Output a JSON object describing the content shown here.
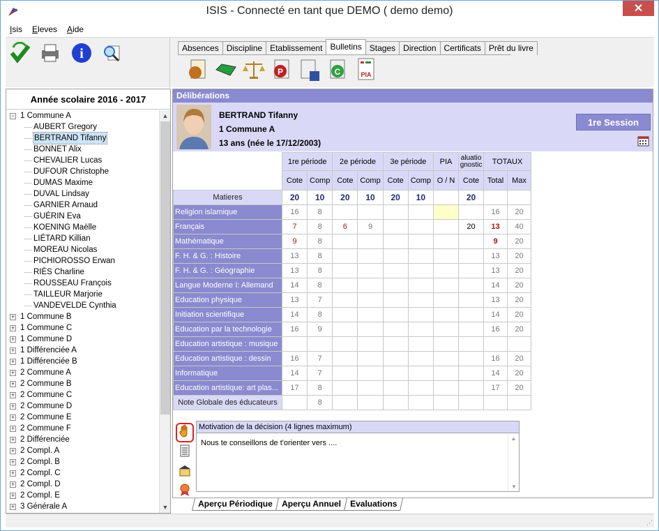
{
  "window": {
    "title": "ISIS - Connecté en tant que DEMO ( demo demo)",
    "close": "✕"
  },
  "menu": [
    {
      "label": "Isis",
      "key": "I"
    },
    {
      "label": "Eleves",
      "key": "E"
    },
    {
      "label": "Aide",
      "key": "A"
    }
  ],
  "tabs": [
    "Absences",
    "Discipline",
    "Etablissement",
    "Bulletins",
    "Stages",
    "Direction",
    "Certificats",
    "Prêt du livre"
  ],
  "active_tab": "Bulletins",
  "school_year": "Année scolaire 2016 - 2017",
  "tree": {
    "open_class": "1 Commune A",
    "students": [
      "AUBERT Gregory",
      "BERTRAND Tifanny",
      "BONNET Alix",
      "CHEVALIER Lucas",
      "DUFOUR Christophe",
      "DUMAS Maxime",
      "DUVAL Lindsay",
      "GARNIER Arnaud",
      "GUÉRIN Eva",
      "KOENING Maëlle",
      "LIÉTARD Killian",
      "MOREAU Nicolas",
      "PICHIOROSSO Erwan",
      "RIÈS Charline",
      "ROUSSEAU François",
      "TAILLEUR Marjorie",
      "VANDEVELDE Cynthia"
    ],
    "selected": "BERTRAND Tifanny",
    "classes": [
      "1 Commune B",
      "1 Commune C",
      "1 Commune D",
      "1 Différenciée A",
      "1 Différenciée B",
      "2 Commune A",
      "2 Commune B",
      "2 Commune C",
      "2 Commune D",
      "2 Commune E",
      "2 Commune F",
      "2 Différenciée",
      "2 Compl. A",
      "2 Compl. B",
      "2 Compl. C",
      "2 Compl. D",
      "2 Compl. E",
      "3 Générale A"
    ]
  },
  "panel_title": "Délibérations",
  "student": {
    "name": "BERTRAND Tifanny",
    "class": "1 Commune A",
    "age": "13 ans (née le 17/12/2003)"
  },
  "session": "1re Session",
  "grid": {
    "periods": [
      "1re période",
      "2e période",
      "3e période",
      "PIA",
      "aluatio gnostic",
      "TOTAUX"
    ],
    "sub": [
      "Cote",
      "Comp",
      "Cote",
      "Comp",
      "Cote",
      "Comp",
      "O / N",
      "Cote",
      "Total",
      "Max"
    ],
    "matieres": "Matieres",
    "weights": [
      "20",
      "10",
      "20",
      "10",
      "20",
      "10",
      "",
      "20",
      "",
      ""
    ],
    "rows": [
      {
        "subject": "Religion islamique",
        "c": [
          "16",
          "8",
          "",
          "",
          "",
          "",
          "",
          "",
          "16",
          "20"
        ]
      },
      {
        "subject": "Français",
        "c": [
          "7",
          "8",
          "6",
          "9",
          "",
          "",
          "",
          "20",
          "13",
          "40"
        ]
      },
      {
        "subject": "Mathématique",
        "c": [
          "9",
          "8",
          "",
          "",
          "",
          "",
          "",
          "",
          "9",
          "20"
        ]
      },
      {
        "subject": "F. H. & G. : Histoire",
        "c": [
          "13",
          "8",
          "",
          "",
          "",
          "",
          "",
          "",
          "13",
          "20"
        ]
      },
      {
        "subject": "F. H. & G. : Géographie",
        "c": [
          "13",
          "8",
          "",
          "",
          "",
          "",
          "",
          "",
          "13",
          "20"
        ]
      },
      {
        "subject": "Langue Moderne I: Allemand",
        "c": [
          "14",
          "8",
          "",
          "",
          "",
          "",
          "",
          "",
          "14",
          "20"
        ]
      },
      {
        "subject": "Education physique",
        "c": [
          "13",
          "7",
          "",
          "",
          "",
          "",
          "",
          "",
          "13",
          "20"
        ]
      },
      {
        "subject": "Initiation scientifique",
        "c": [
          "14",
          "8",
          "",
          "",
          "",
          "",
          "",
          "",
          "14",
          "20"
        ]
      },
      {
        "subject": "Education par la technologie",
        "c": [
          "16",
          "9",
          "",
          "",
          "",
          "",
          "",
          "",
          "16",
          "20"
        ]
      },
      {
        "subject": "Education artistique : musique",
        "c": [
          "",
          "",
          "",
          "",
          "",
          "",
          "",
          "",
          "",
          ""
        ]
      },
      {
        "subject": "Education artistique : dessin",
        "c": [
          "16",
          "7",
          "",
          "",
          "",
          "",
          "",
          "",
          "16",
          "20"
        ]
      },
      {
        "subject": "Informatique",
        "c": [
          "14",
          "7",
          "",
          "",
          "",
          "",
          "",
          "",
          "14",
          "20"
        ]
      },
      {
        "subject": "Education artistique: art plas...",
        "c": [
          "17",
          "8",
          "",
          "",
          "",
          "",
          "",
          "",
          "17",
          "20"
        ]
      }
    ],
    "footer": {
      "label": "Note Globale des éducateurs",
      "value": "8"
    }
  },
  "motivation": {
    "header": "Motivation de la décision (4 lignes maximum)",
    "text": "Nous te conseillons de t'orienter vers ...."
  },
  "bottom_tabs": [
    "Aperçu Périodique",
    "Aperçu Annuel",
    "Evaluations"
  ],
  "colors": {
    "accent": "#8a8ad0",
    "light": "#d9d9f7",
    "red": "#b01010",
    "navy": "#1c2a7a"
  }
}
